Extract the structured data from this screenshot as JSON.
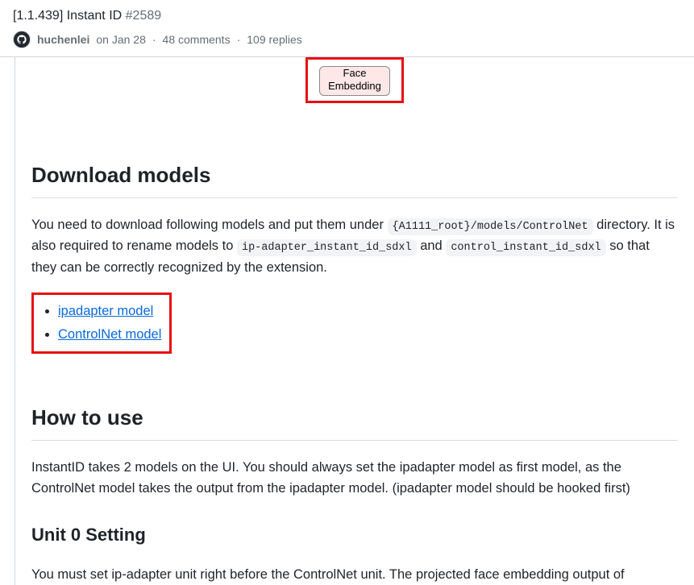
{
  "header": {
    "title_prefix": "[1.1.439] Instant ID",
    "issue_number": "#2589",
    "author": "huchenlei",
    "date": "on Jan 28",
    "comments": "48 comments",
    "replies": "109 replies"
  },
  "diagram": {
    "chip_line1": "Face",
    "chip_line2": "Embedding"
  },
  "sections": {
    "download": {
      "heading": "Download models",
      "p1_a": "You need to download following models and put them under ",
      "code1": "{A1111_root}/models/ControlNet",
      "p1_b": " directory. It is also required to rename models to ",
      "code2": "ip-adapter_instant_id_sdxl",
      "p1_c": " and ",
      "code3": "control_instant_id_sdxl",
      "p1_d": " so that they can be correctly recognized by the extension.",
      "links": [
        "ipadapter model",
        "ControlNet model"
      ]
    },
    "howto": {
      "heading": "How to use",
      "p1": "InstantID takes 2 models on the UI. You should always set the ipadapter model as first model, as the ControlNet model takes the output from the ipadapter model. (ipadapter model should be hooked first)"
    },
    "unit0": {
      "heading": "Unit 0 Setting",
      "p1": "You must set ip-adapter unit right before the ControlNet unit. The projected face embedding output of"
    }
  }
}
